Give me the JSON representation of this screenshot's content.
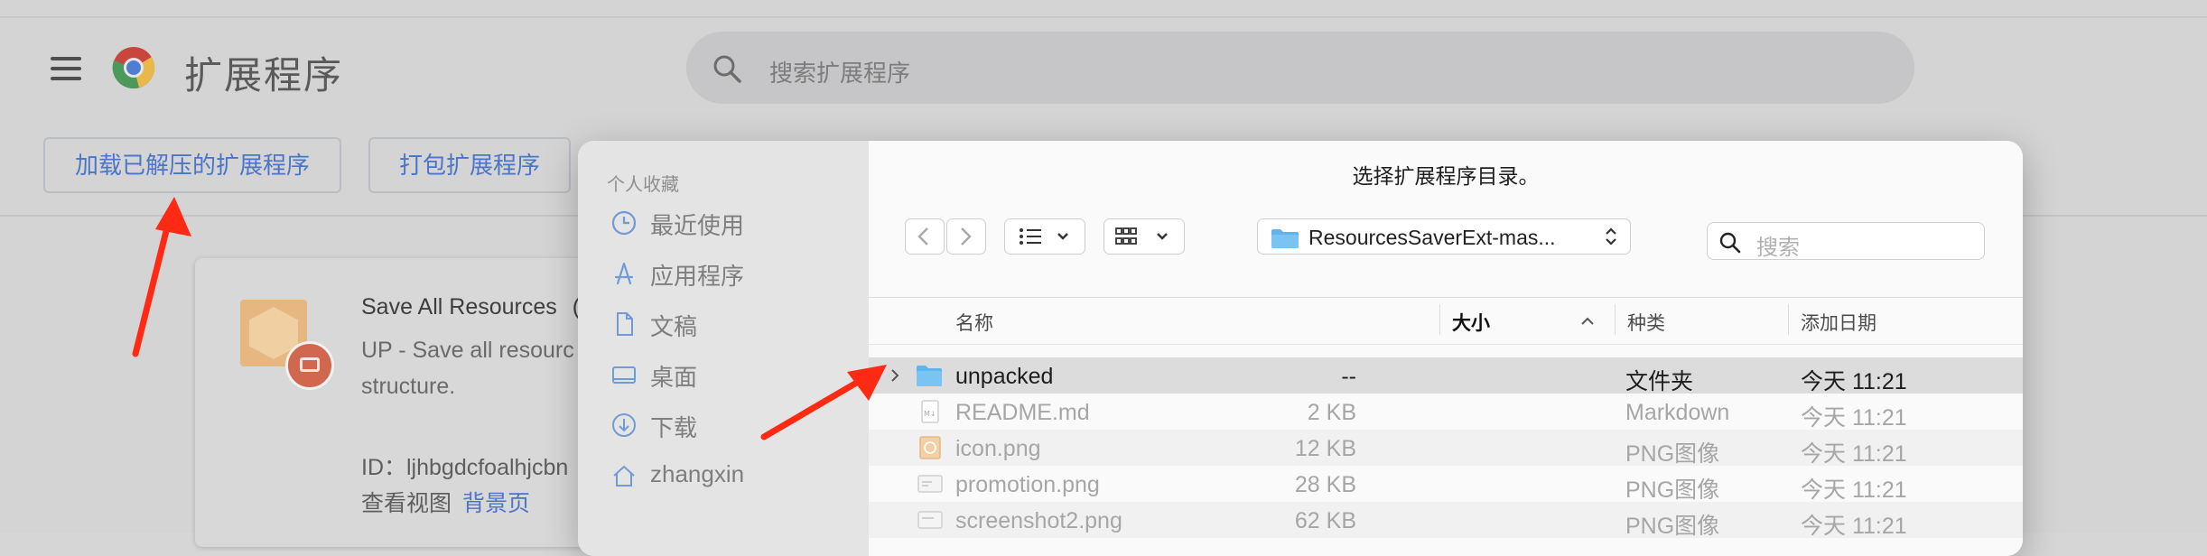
{
  "bg": {
    "page_title": "扩展程序",
    "search_placeholder": "搜索扩展程序",
    "load_unpacked_label": "加载已解压的扩展程序",
    "pack_label": "打包扩展程序",
    "extension": {
      "name": "Save All Resources",
      "name_tail": "(",
      "description": "UP - Save all resourc structure.",
      "id_text": "ID：ljhbgdcfoalhjcbn",
      "views_label": "查看视图",
      "background_page_link": "背景页"
    }
  },
  "dialog": {
    "title": "选择扩展程序目录。",
    "sidebar": {
      "heading": "个人收藏",
      "items": [
        {
          "label": "最近使用",
          "icon": "clock-icon"
        },
        {
          "label": "应用程序",
          "icon": "applications-icon"
        },
        {
          "label": "文稿",
          "icon": "document-icon"
        },
        {
          "label": "桌面",
          "icon": "desktop-icon"
        },
        {
          "label": "下载",
          "icon": "download-icon"
        },
        {
          "label": "zhangxin",
          "icon": "home-icon"
        }
      ]
    },
    "current_folder": "ResourcesSaverExt-mas...",
    "search_placeholder": "搜索",
    "columns": {
      "name": "名称",
      "size": "大小",
      "kind": "种类",
      "date_added": "添加日期"
    },
    "files": [
      {
        "name": "unpacked",
        "size": "--",
        "kind": "文件夹",
        "date": "今天 11:21",
        "icon": "folder-icon",
        "selected": true,
        "enabled": true
      },
      {
        "name": "README.md",
        "size": "2 KB",
        "kind": "Markdown",
        "date": "今天 11:21",
        "icon": "markdown-file-icon",
        "selected": false,
        "enabled": false
      },
      {
        "name": "icon.png",
        "size": "12 KB",
        "kind": "PNG图像",
        "date": "今天 11:21",
        "icon": "image-file-icon",
        "selected": false,
        "enabled": false
      },
      {
        "name": "promotion.png",
        "size": "28 KB",
        "kind": "PNG图像",
        "date": "今天 11:21",
        "icon": "image-file-icon",
        "selected": false,
        "enabled": false
      },
      {
        "name": "screenshot2.png",
        "size": "62 KB",
        "kind": "PNG图像",
        "date": "今天 11:21",
        "icon": "image-file-icon",
        "selected": false,
        "enabled": false
      }
    ]
  },
  "colors": {
    "accent_blue": "#4a75c9",
    "annotation_red": "#ff2a14",
    "folder_blue": "#5fb4ec"
  }
}
